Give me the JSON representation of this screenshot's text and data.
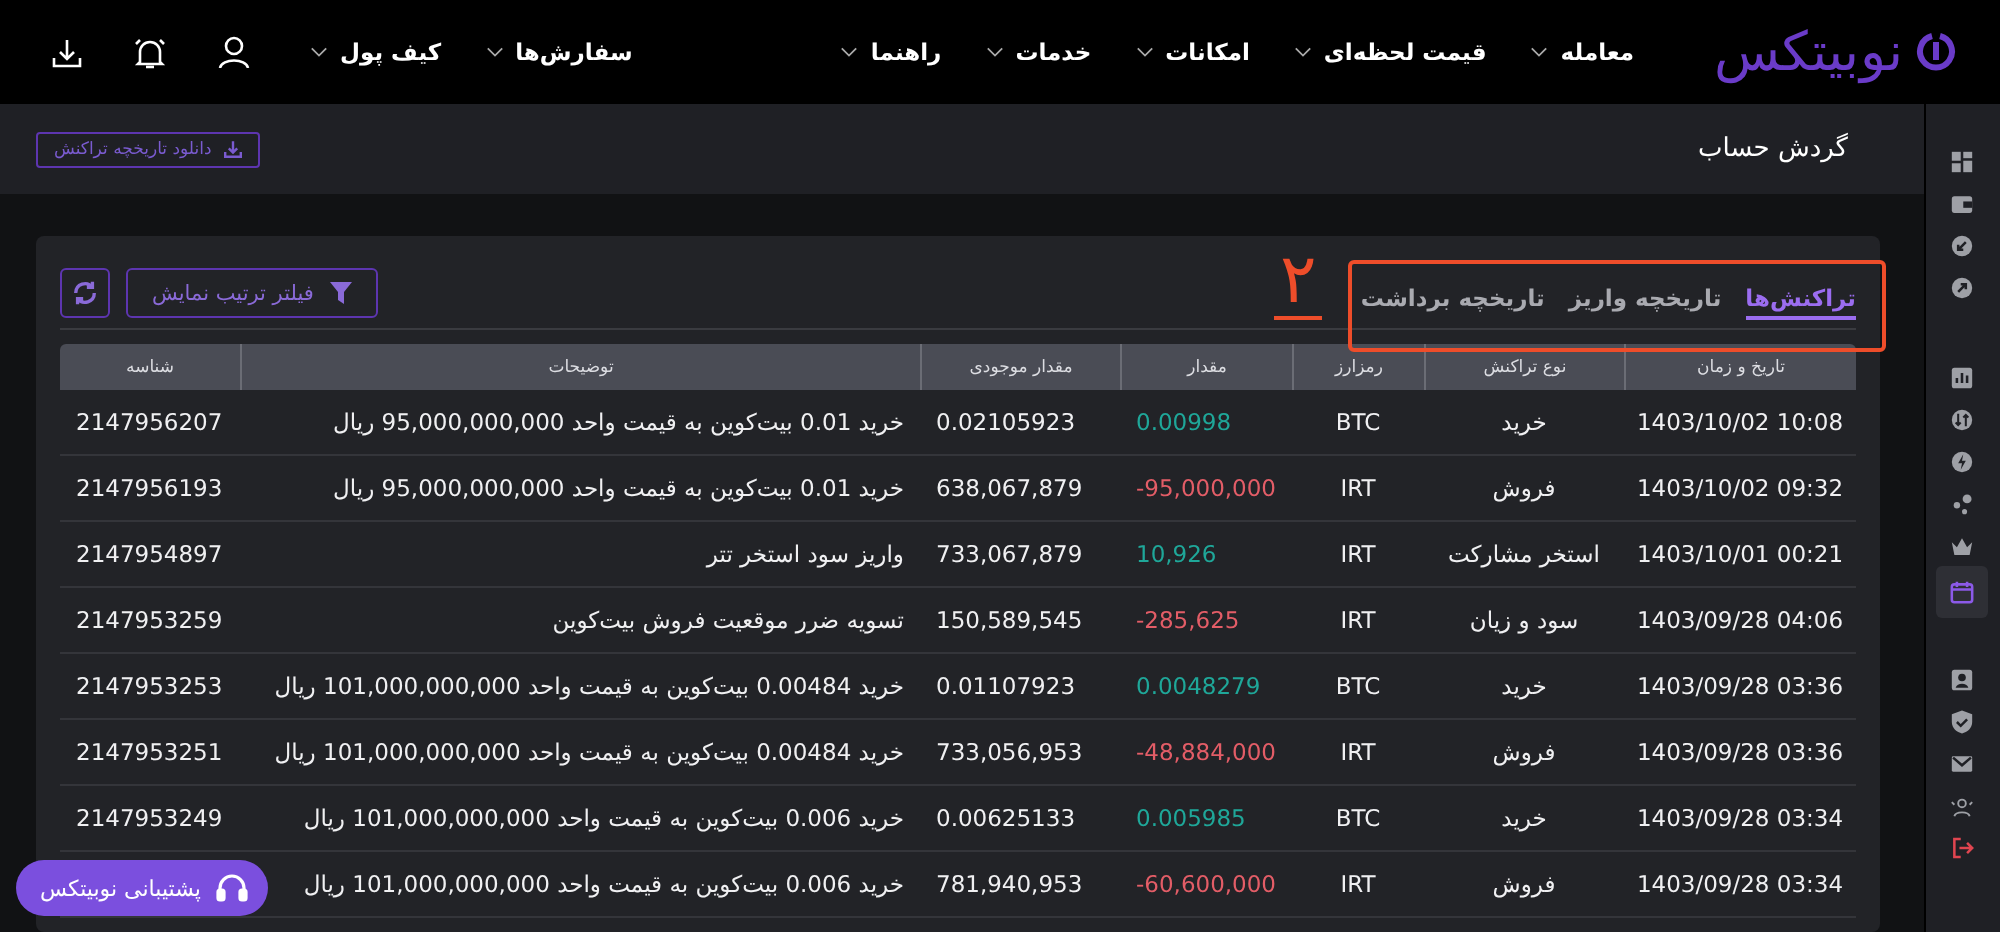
{
  "logo": {
    "text": "نوبیتکس"
  },
  "main_menu": [
    {
      "label": "معامله"
    },
    {
      "label": "قیمت لحظه‌ای"
    },
    {
      "label": "امکانات"
    },
    {
      "label": "خدمات"
    },
    {
      "label": "راهنما"
    }
  ],
  "account_menu": [
    {
      "label": "سفارش‌ها"
    },
    {
      "label": "کیف پول"
    }
  ],
  "page_header": {
    "title": "گردش حساب",
    "download_button": "دانلود تاریخچه تراکنش"
  },
  "tabs": [
    {
      "label": "تراکنش‌ها",
      "selected": true
    },
    {
      "label": "تاریخچه واریز",
      "selected": false
    },
    {
      "label": "تاریخچه برداشت",
      "selected": false
    }
  ],
  "filter_button": "فیلتر ترتیب نمایش",
  "annotation": {
    "label": "۲"
  },
  "table": {
    "columns": [
      "تاریخ و زمان",
      "نوع تراکنش",
      "رمزارز",
      "مقدار",
      "مقدار موجودی",
      "توضیحات",
      "شناسه"
    ],
    "rows": [
      {
        "date": "1403/10/02 10:08",
        "type": "خرید",
        "coin": "BTC",
        "amount": "0.00998",
        "kind": "credit",
        "balance": "0.02105923",
        "description": "خرید 0.01 بیت‌کوین به قیمت واحد 95,000,000,000 ریال",
        "id": "2147956207"
      },
      {
        "date": "1403/10/02 09:32",
        "type": "فروش",
        "coin": "IRT",
        "amount": "-95,000,000",
        "kind": "debit",
        "balance": "638,067,879",
        "description": "خرید 0.01 بیت‌کوین به قیمت واحد 95,000,000,000 ریال",
        "id": "2147956193"
      },
      {
        "date": "1403/10/01 00:21",
        "type": "استخر مشارکت",
        "coin": "IRT",
        "amount": "10,926",
        "kind": "credit",
        "balance": "733,067,879",
        "description": "واریز سود استخر تتر",
        "id": "2147954897"
      },
      {
        "date": "1403/09/28 04:06",
        "type": "سود و زیان",
        "coin": "IRT",
        "amount": "-285,625",
        "kind": "debit",
        "balance": "150,589,545",
        "description": "تسویه ضرر موقعیت فروش بیت‌کوین",
        "id": "2147953259"
      },
      {
        "date": "1403/09/28 03:36",
        "type": "خرید",
        "coin": "BTC",
        "amount": "0.0048279",
        "kind": "credit",
        "balance": "0.01107923",
        "description": "خرید 0.00484 بیت‌کوین به قیمت واحد 101,000,000,000 ریال",
        "id": "2147953253"
      },
      {
        "date": "1403/09/28 03:36",
        "type": "فروش",
        "coin": "IRT",
        "amount": "-48,884,000",
        "kind": "debit",
        "balance": "733,056,953",
        "description": "خرید 0.00484 بیت‌کوین به قیمت واحد 101,000,000,000 ریال",
        "id": "2147953251"
      },
      {
        "date": "1403/09/28 03:34",
        "type": "خرید",
        "coin": "BTC",
        "amount": "0.005985",
        "kind": "credit",
        "balance": "0.00625133",
        "description": "خرید 0.006 بیت‌کوین به قیمت واحد 101,000,000,000 ریال",
        "id": "2147953249"
      },
      {
        "date": "1403/09/28 03:34",
        "type": "فروش",
        "coin": "IRT",
        "amount": "-60,600,000",
        "kind": "debit",
        "balance": "781,940,953",
        "description": "خرید 0.006 بیت‌کوین به قیمت واحد 101,000,000,000 ریال"
      }
    ]
  },
  "support_button": "پشتیبانی نوبیتکس",
  "sidebar": [
    {
      "kind": "link",
      "selected": false
    },
    {
      "kind": "link",
      "selected": false
    },
    {
      "kind": "link",
      "selected": false
    },
    {
      "kind": "link",
      "selected": false
    },
    {
      "kind": "link",
      "selected": false
    },
    {
      "kind": "link",
      "selected": false
    },
    {
      "kind": "link",
      "selected": false
    },
    {
      "kind": "link",
      "selected": false
    },
    {
      "kind": "link",
      "selected": false
    },
    {
      "kind": "link",
      "selected": true
    },
    {
      "kind": "link",
      "selected": false
    },
    {
      "kind": "link",
      "selected": false
    },
    {
      "kind": "link",
      "selected": false
    },
    {
      "kind": "link",
      "selected": false
    },
    {
      "kind": "logout",
      "selected": false
    }
  ]
}
